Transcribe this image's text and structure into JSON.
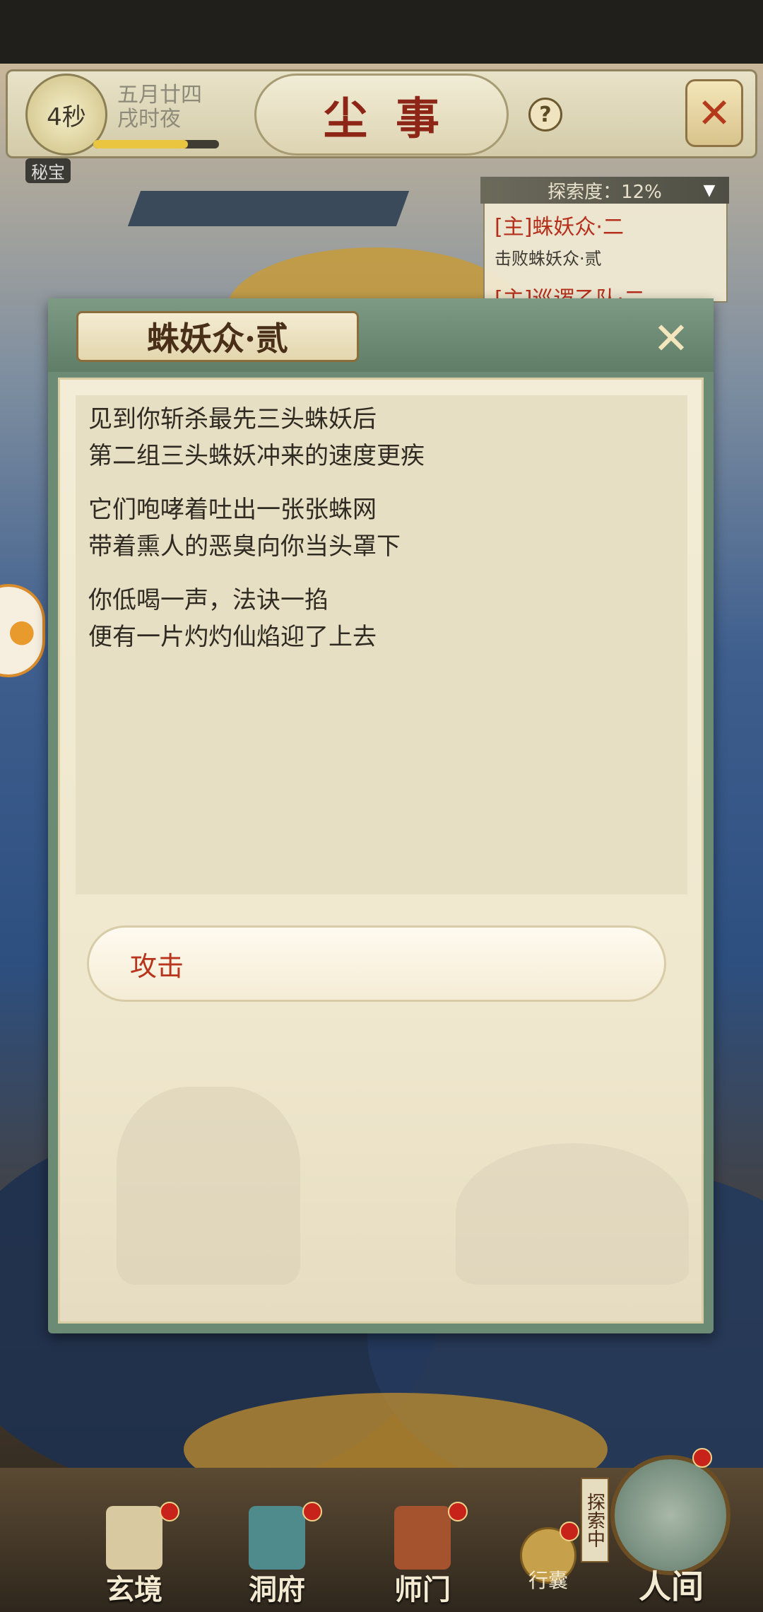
{
  "top_bar": {
    "timer": "4秒",
    "date_line1": "五月廿四",
    "date_line2": "戌时夜",
    "time_progress": 0.75,
    "title": "尘事",
    "help_icon": "question-icon",
    "map_icon": "crossed-map-icon"
  },
  "map_overlay": {
    "mibao_label": "秘宝",
    "explore_degree": "探索度：12%",
    "quests": [
      {
        "title": "[主]蛛妖众·二",
        "subtitle": "击败蛛妖众·贰"
      },
      {
        "title": "[主]巡逻乙队·二",
        "subtitle": ""
      }
    ]
  },
  "dialog": {
    "title": "蛛妖众·贰",
    "close_icon": "close-icon",
    "paragraphs": [
      {
        "line1": "见到你斩杀最先三头蛛妖后",
        "line2": "第二组三头蛛妖冲来的速度更疾"
      },
      {
        "line1": "它们咆哮着吐出一张张蛛网",
        "line2": "带着熏人的恶臭向你当头罩下"
      },
      {
        "line1": "你低喝一声，法诀一掐",
        "line2": "便有一片灼灼仙焰迎了上去"
      }
    ],
    "option_attack": "攻击"
  },
  "bottom_nav": {
    "items": [
      {
        "label": "玄境",
        "icon": "scroll-icon"
      },
      {
        "label": "洞府",
        "icon": "lantern-icon"
      },
      {
        "label": "师门",
        "icon": "banner-icon"
      }
    ],
    "bag_label": "行囊",
    "exploring_tag": "探索中",
    "realm_label": "人间"
  },
  "colors": {
    "title_red": "#8e2617",
    "option_red": "#b9341d",
    "dialog_green": "#6c8b74",
    "parchment": "#efe7cd"
  }
}
